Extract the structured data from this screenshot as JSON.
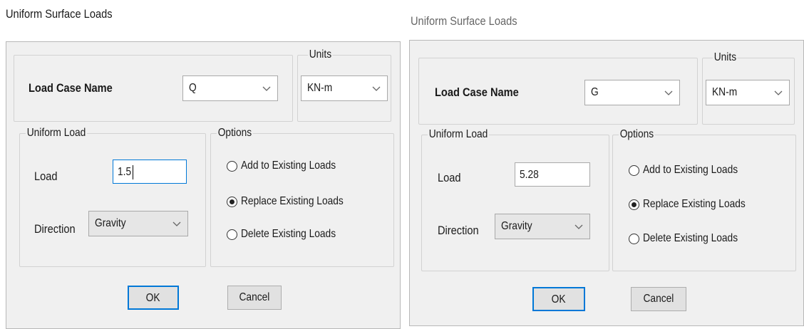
{
  "dialogs": [
    {
      "title": "Uniform Surface Loads",
      "load_case_label": "Load Case Name",
      "load_case_value": "Q",
      "units_label": "Units",
      "units_value": "KN-m",
      "uniform_load_label": "Uniform Load",
      "load_label": "Load",
      "load_value": "1.5",
      "direction_label": "Direction",
      "direction_value": "Gravity",
      "options_label": "Options",
      "options": [
        "Add to Existing Loads",
        "Replace Existing Loads",
        "Delete Existing Loads"
      ],
      "selected_option": 1,
      "ok_label": "OK",
      "cancel_label": "Cancel"
    },
    {
      "title": "Uniform Surface Loads",
      "load_case_label": "Load Case Name",
      "load_case_value": "G",
      "units_label": "Units",
      "units_value": "KN-m",
      "uniform_load_label": "Uniform Load",
      "load_label": "Load",
      "load_value": "5.28",
      "direction_label": "Direction",
      "direction_value": "Gravity",
      "options_label": "Options",
      "options": [
        "Add to Existing Loads",
        "Replace Existing Loads",
        "Delete Existing Loads"
      ],
      "selected_option": 1,
      "ok_label": "OK",
      "cancel_label": "Cancel"
    }
  ],
  "icons": {
    "dropdown": "chevron-down-icon",
    "radio": "radio-icon"
  },
  "colors": {
    "dialog_bg": "#f0f0f0",
    "accent_focus": "#0078d7",
    "button_bg": "#e1e1e1"
  }
}
